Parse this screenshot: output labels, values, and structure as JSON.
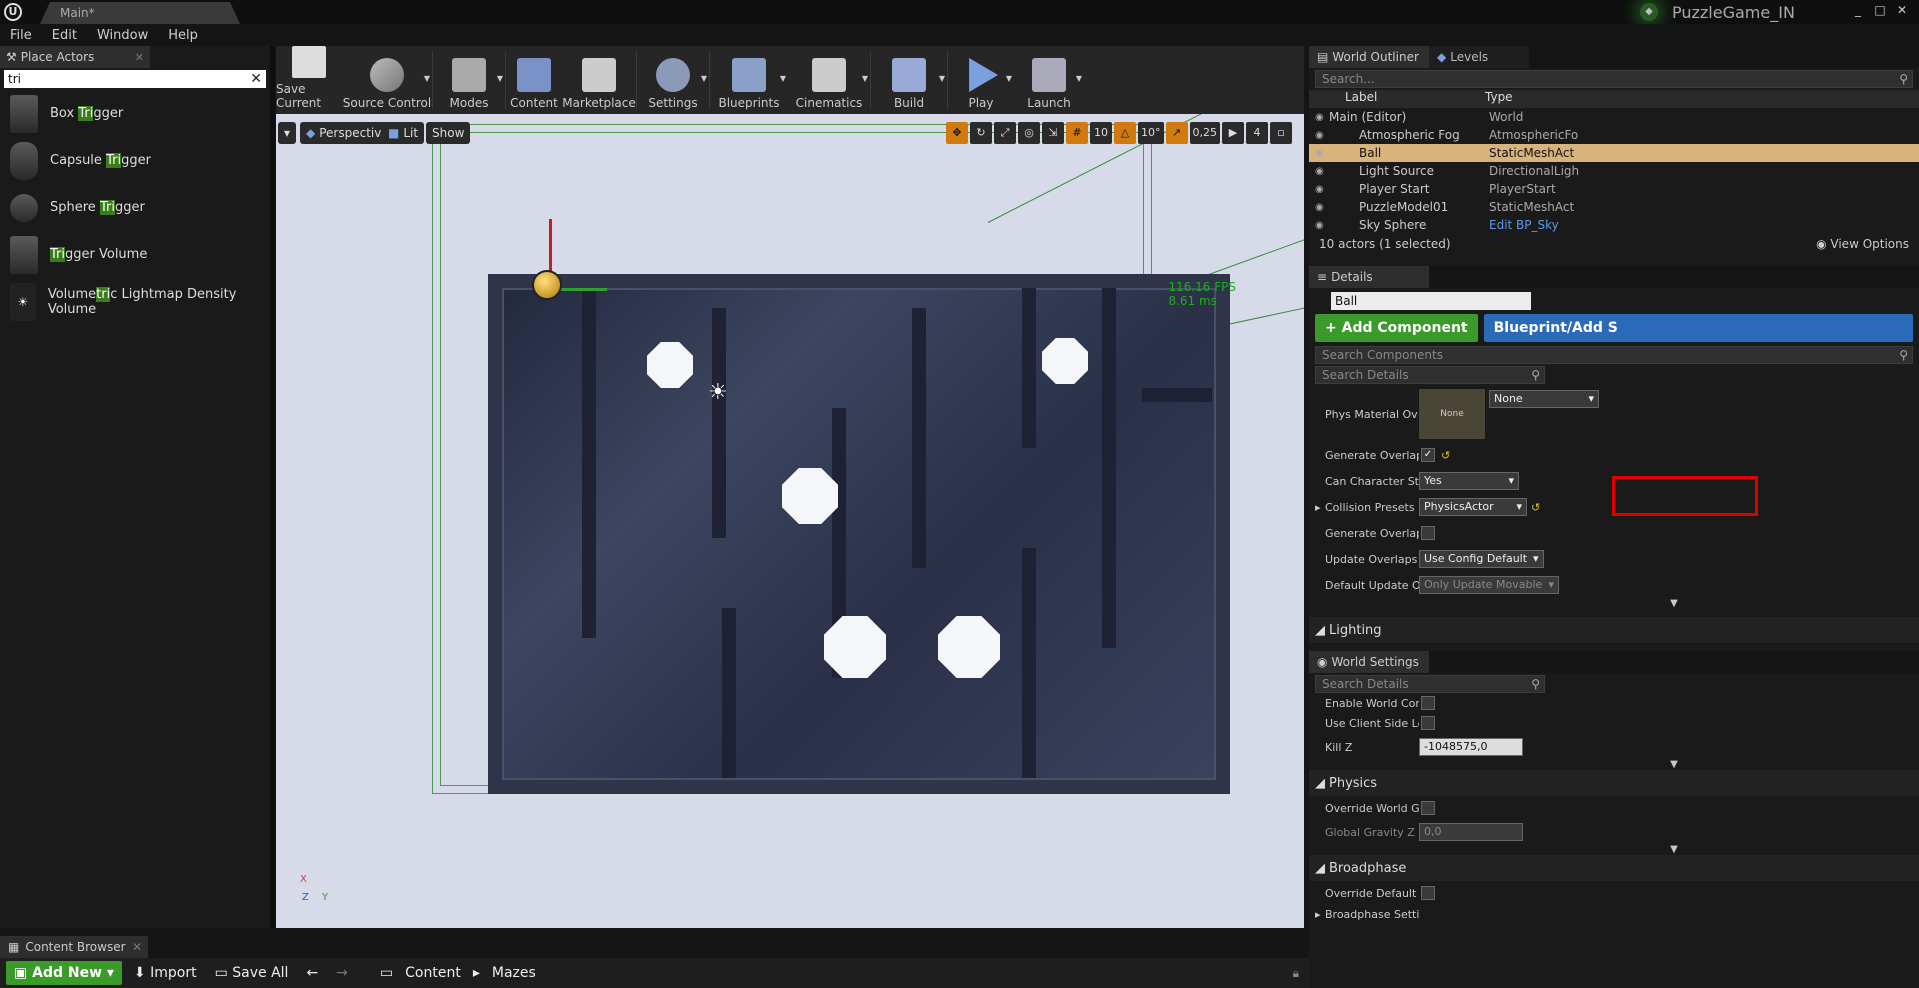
{
  "titlebar": {
    "doc_tab": "Main*",
    "project": "PuzzleGame_IN",
    "minimize": "_",
    "maximize": "□",
    "close": "✕"
  },
  "menu": [
    "File",
    "Edit",
    "Window",
    "Help"
  ],
  "place_actors": {
    "tab": "Place Actors",
    "search_value": "tri",
    "items": [
      {
        "pre": "Box ",
        "hl": "Tri",
        "post": "gger"
      },
      {
        "pre": "Capsule ",
        "hl": "Tri",
        "post": "gger"
      },
      {
        "pre": "Sphere ",
        "hl": "Tri",
        "post": "gger"
      },
      {
        "pre": "",
        "hl": "Tri",
        "post": "gger Volume"
      },
      {
        "pre": "Volume",
        "hl": "tri",
        "post": "c Lightmap Density Volume"
      }
    ]
  },
  "toolbar": {
    "save": "Save Current",
    "source": "Source Control",
    "modes": "Modes",
    "content": "Content",
    "marketplace": "Marketplace",
    "settings": "Settings",
    "blueprints": "Blueprints",
    "cinematics": "Cinematics",
    "build": "Build",
    "play": "Play",
    "launch": "Launch"
  },
  "viewport": {
    "perspective": "Perspective",
    "lit": "Lit",
    "show": "Show",
    "grid": "10",
    "angle": "10°",
    "scale": "0,25",
    "speed": "4",
    "fps": "116.16 FPS",
    "ms": "8.61 ms",
    "axis_x": "X",
    "axis_y": "Y",
    "axis_z": "Z"
  },
  "outliner": {
    "tab": "World Outliner",
    "levels_tab": "Levels",
    "search_placeholder": "Search...",
    "col_label": "Label",
    "col_type": "Type",
    "rows": [
      {
        "name": "Main (Editor)",
        "type": "World"
      },
      {
        "name": "Atmospheric Fog",
        "type": "AtmosphericFo"
      },
      {
        "name": "Ball",
        "type": "StaticMeshAct"
      },
      {
        "name": "Light Source",
        "type": "DirectionalLigh"
      },
      {
        "name": "Player Start",
        "type": "PlayerStart"
      },
      {
        "name": "PuzzleModel01",
        "type": "StaticMeshAct"
      },
      {
        "name": "Sky Sphere",
        "type": "Edit BP_Sky"
      }
    ],
    "status": "10 actors (1 selected)",
    "view_options": "View Options"
  },
  "details": {
    "tab": "Details",
    "name": "Ball",
    "add_component": "+ Add Component",
    "blueprint": "Blueprint/Add S",
    "search_components": "Search Components",
    "search_details": "Search Details",
    "phys_material_label": "Phys Material Ov",
    "phys_thumb": "None",
    "phys_dd": "None",
    "gen_overlap_label": "Generate Overlap",
    "can_char_label": "Can Character Ste",
    "can_char_value": "Yes",
    "collision_label": "Collision Presets",
    "collision_value": "PhysicsActor",
    "gen_overlap2_label": "Generate Overlap",
    "update_overlaps_label": "Update Overlaps",
    "update_overlaps_value": "Use Config Default",
    "default_update_label": "Default Update Ov",
    "default_update_value": "Only Update Movable",
    "lighting": "Lighting"
  },
  "world_settings": {
    "tab": "World Settings",
    "search_details": "Search Details",
    "enable_world": "Enable World Com",
    "client_side": "Use Client Side Le",
    "kill_z_label": "Kill Z",
    "kill_z_value": "-1048575,0",
    "physics": "Physics",
    "override_gravity": "Override World Gr",
    "global_gravity_label": "Global Gravity Z",
    "global_gravity_value": "0,0",
    "broadphase": "Broadphase",
    "override_default": "Override Default B",
    "broadphase_settings": "Broadphase Setti"
  },
  "content_browser": {
    "tab": "Content Browser",
    "add_new": "Add New",
    "import": "Import",
    "save_all": "Save All",
    "path": [
      "Content",
      "Mazes"
    ]
  }
}
